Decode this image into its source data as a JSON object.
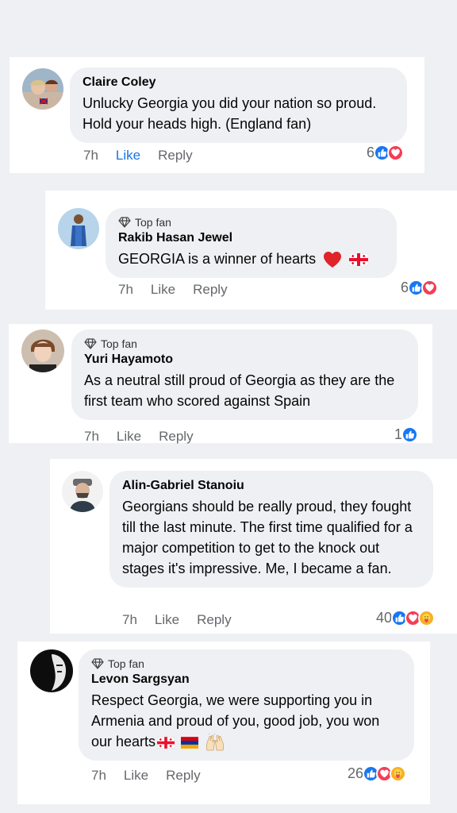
{
  "comments": [
    {
      "top_fan": false,
      "name": "Claire Coley",
      "text": "Unlucky Georgia you did your nation so proud. Hold your heads high. (England fan)",
      "time": "7h",
      "like": "Like",
      "reply": "Reply",
      "like_active": true,
      "reaction_count": "6",
      "reactions": [
        "like-icon",
        "love-icon"
      ]
    },
    {
      "top_fan": true,
      "badge": "Top fan",
      "name": "Rakib Hasan Jewel",
      "text": "GEORGIA is a winner of hearts",
      "emojis": [
        "red-heart-emoji",
        "georgia-flag-emoji"
      ],
      "time": "7h",
      "like": "Like",
      "reply": "Reply",
      "reaction_count": "6",
      "reactions": [
        "like-icon",
        "love-icon"
      ]
    },
    {
      "top_fan": true,
      "badge": "Top fan",
      "name": "Yuri Hayamoto",
      "text": "As a neutral still proud of Georgia as they are the first team who scored against Spain",
      "time": "7h",
      "like": "Like",
      "reply": "Reply",
      "reaction_count": "1",
      "reactions": [
        "like-icon"
      ]
    },
    {
      "top_fan": false,
      "name": "Alin-Gabriel Stanoiu",
      "text": "Georgians should be really proud, they fought till the last minute. The first time qualified for a major competition to get to the knock out stages it's impressive. Me, I became a fan.",
      "time": "7h",
      "like": "Like",
      "reply": "Reply",
      "reaction_count": "40",
      "reactions": [
        "like-icon",
        "love-icon",
        "care-icon"
      ]
    },
    {
      "top_fan": true,
      "badge": "Top fan",
      "name": "Levon Sargsyan",
      "text": "Respect Georgia, we were supporting you in Armenia and proud of you, good job, you won our hearts",
      "emojis": [
        "georgia-flag-emoji",
        "armenia-flag-emoji",
        "raising-hands-emoji"
      ],
      "time": "7h",
      "like": "Like",
      "reply": "Reply",
      "reaction_count": "26",
      "reactions": [
        "like-icon",
        "love-icon",
        "care-icon"
      ]
    }
  ],
  "colors": {
    "like_blue": "#1877f2",
    "love_red": "#f33e58",
    "care_yellow": "#f7b125",
    "bubble": "#eef0f3",
    "meta_grey": "#65676b"
  }
}
